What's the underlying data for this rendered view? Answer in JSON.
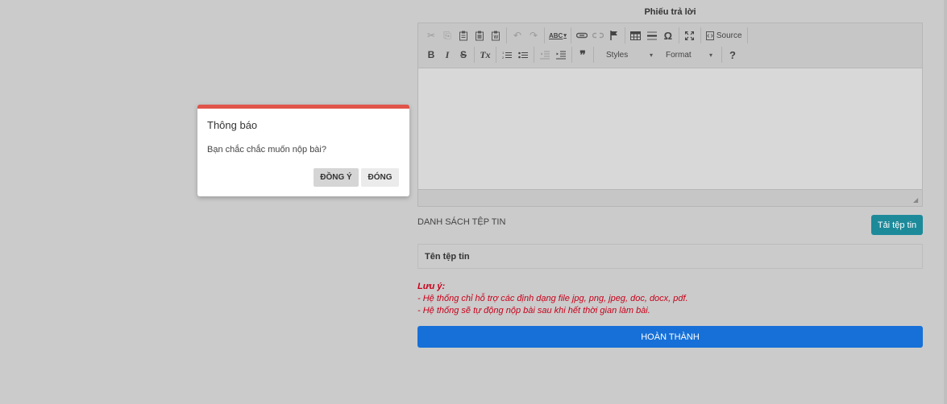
{
  "panel": {
    "title": "Phiếu trả lời"
  },
  "editor": {
    "toolbar_row1": {
      "cut_icon": "✂",
      "copy_icon": "⎘",
      "paste_icon": "📋",
      "paste_text_icon": "📋",
      "paste_word_icon": "📋",
      "undo_icon": "↶",
      "redo_icon": "↷",
      "spell_icon": "ABC",
      "link_icon": "🔗",
      "unlink_icon": "⛓",
      "anchor_icon": "⚑",
      "table_icon": "▦",
      "hr_icon": "☰",
      "special_char_icon": "Ω",
      "maximize_icon": "⛶",
      "source_icon": "▣",
      "source_label": "Source"
    },
    "toolbar_row2": {
      "bold_label": "B",
      "italic_label": "I",
      "strike_label": "S",
      "remove_format_label": "Tx",
      "ordered_list_icon": "≡",
      "bullet_list_icon": "≔",
      "outdent_icon": "⇤",
      "indent_icon": "⇥",
      "blockquote_icon": "❞",
      "styles_label": "Styles",
      "format_label": "Format",
      "dropdown_arrow": "▾",
      "help_icon": "?"
    },
    "resize_icon": "◢"
  },
  "files": {
    "section_label": "DANH SÁCH TỆP TIN",
    "upload_label": "Tải tệp tin",
    "column_header": "Tên tệp tin"
  },
  "note": {
    "title": "Lưu ý:",
    "line1": "- Hệ thống chỉ hỗ trợ các định dạng file jpg, png, jpeg, doc, docx, pdf.",
    "line2": "- Hệ thống sẽ tự động nộp bài sau khi hết thời gian làm bài."
  },
  "finish": {
    "label": "HOÀN THÀNH"
  },
  "modal": {
    "title": "Thông báo",
    "message": "Bạn chắc chắc muốn nộp bài?",
    "agree_label": "ĐỒNG Ý",
    "close_label": "ĐÓNG"
  },
  "colors": {
    "backdrop": "#cbcbcb",
    "modal_accent": "#e0544a",
    "upload_button": "#1d8a9a",
    "finish_button": "#1670d8",
    "note_text": "#c8001a"
  }
}
